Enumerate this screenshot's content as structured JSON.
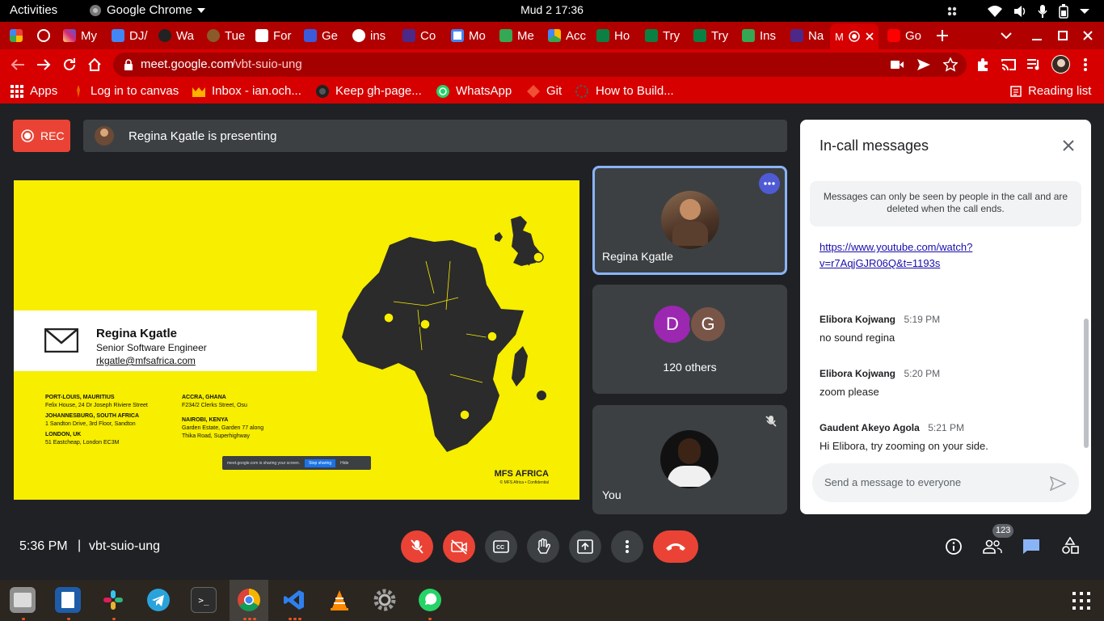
{
  "system": {
    "activities": "Activities",
    "app_name": "Google Chrome",
    "clock": "Mud 2  17:36"
  },
  "tabs": [
    {
      "label": ""
    },
    {
      "label": ""
    },
    {
      "label": "My"
    },
    {
      "label": "DJ/"
    },
    {
      "label": "Wa"
    },
    {
      "label": "Tue"
    },
    {
      "label": "For"
    },
    {
      "label": "Ge"
    },
    {
      "label": "ins"
    },
    {
      "label": "Co"
    },
    {
      "label": "Mo"
    },
    {
      "label": "Me"
    },
    {
      "label": "Acc"
    },
    {
      "label": "Ho"
    },
    {
      "label": "Try"
    },
    {
      "label": "Try"
    },
    {
      "label": "Ins"
    },
    {
      "label": "Na"
    },
    {
      "label": "M"
    },
    {
      "label": "Go"
    }
  ],
  "address": {
    "host": "meet.google.com",
    "path": "/vbt-suio-ung"
  },
  "bookmarks": [
    {
      "label": "Apps"
    },
    {
      "label": "Log in to canvas"
    },
    {
      "label": "Inbox - ian.och..."
    },
    {
      "label": "Keep gh-page..."
    },
    {
      "label": "WhatsApp"
    },
    {
      "label": "Git"
    },
    {
      "label": "How to Build..."
    }
  ],
  "reading_list": "Reading list",
  "meet": {
    "rec_label": "REC",
    "presenting_text": "Regina Kgatle is presenting",
    "tiles": {
      "presenter_name": "Regina Kgatle",
      "others_initials": [
        "D",
        "G"
      ],
      "others_label": "120 others",
      "self_label": "You"
    },
    "time": "5:36 PM",
    "separator": "|",
    "meeting_code": "vbt-suio-ung",
    "participant_count": "123"
  },
  "slide": {
    "name": "Regina Kgatle",
    "title": "Senior Software Engineer",
    "email": "rkgatle@mfsafrica.com",
    "offices": [
      {
        "city": "PORT-LOUIS, MAURITIUS",
        "address": "Felix House, 24 Dr Joseph Riviere Street"
      },
      {
        "city": "JOHANNESBURG, SOUTH AFRICA",
        "address": "1 Sandton Drive, 3rd Floor, Sandton"
      },
      {
        "city": "LONDON, UK",
        "address": "51 Eastcheap, London EC3M"
      },
      {
        "city": "ACCRA, GHANA",
        "address": "F234/2 Clerks Street, Osu"
      },
      {
        "city": "NAIROBI, KENYA",
        "address": "Garden Estate, Garden 77 along Thika Road, Superhighway"
      }
    ],
    "brand": "MFS AFRICA",
    "brand_sub": "© MFS Africa • Confidential",
    "share_text": "meet.google.com is sharing your screen.",
    "share_stop": "Stop sharing",
    "share_hide": "Hide"
  },
  "chat": {
    "title": "In-call messages",
    "notice": "Messages can only be seen by people in the call and are deleted when the call ends.",
    "link_line1": "https://www.youtube.com/watch?",
    "link_line2": "v=r7AqjGJR06Q&t=1193s",
    "messages": [
      {
        "sender": "Elibora Kojwang",
        "time": "5:19 PM",
        "text": "no sound regina"
      },
      {
        "sender": "Elibora Kojwang",
        "time": "5:20 PM",
        "text": "zoom please"
      },
      {
        "sender": "Gaudent Akeyo Agola",
        "time": "5:21 PM",
        "text": "Hi Elibora, try zooming on your side."
      }
    ],
    "input_placeholder": "Send a message to everyone"
  },
  "colors": {
    "chrome_theme": "#d60000",
    "meet_bg": "#202124",
    "end_call": "#ea4335",
    "slide_yellow": "#f7ee00",
    "accent_blue": "#1a73e8"
  }
}
